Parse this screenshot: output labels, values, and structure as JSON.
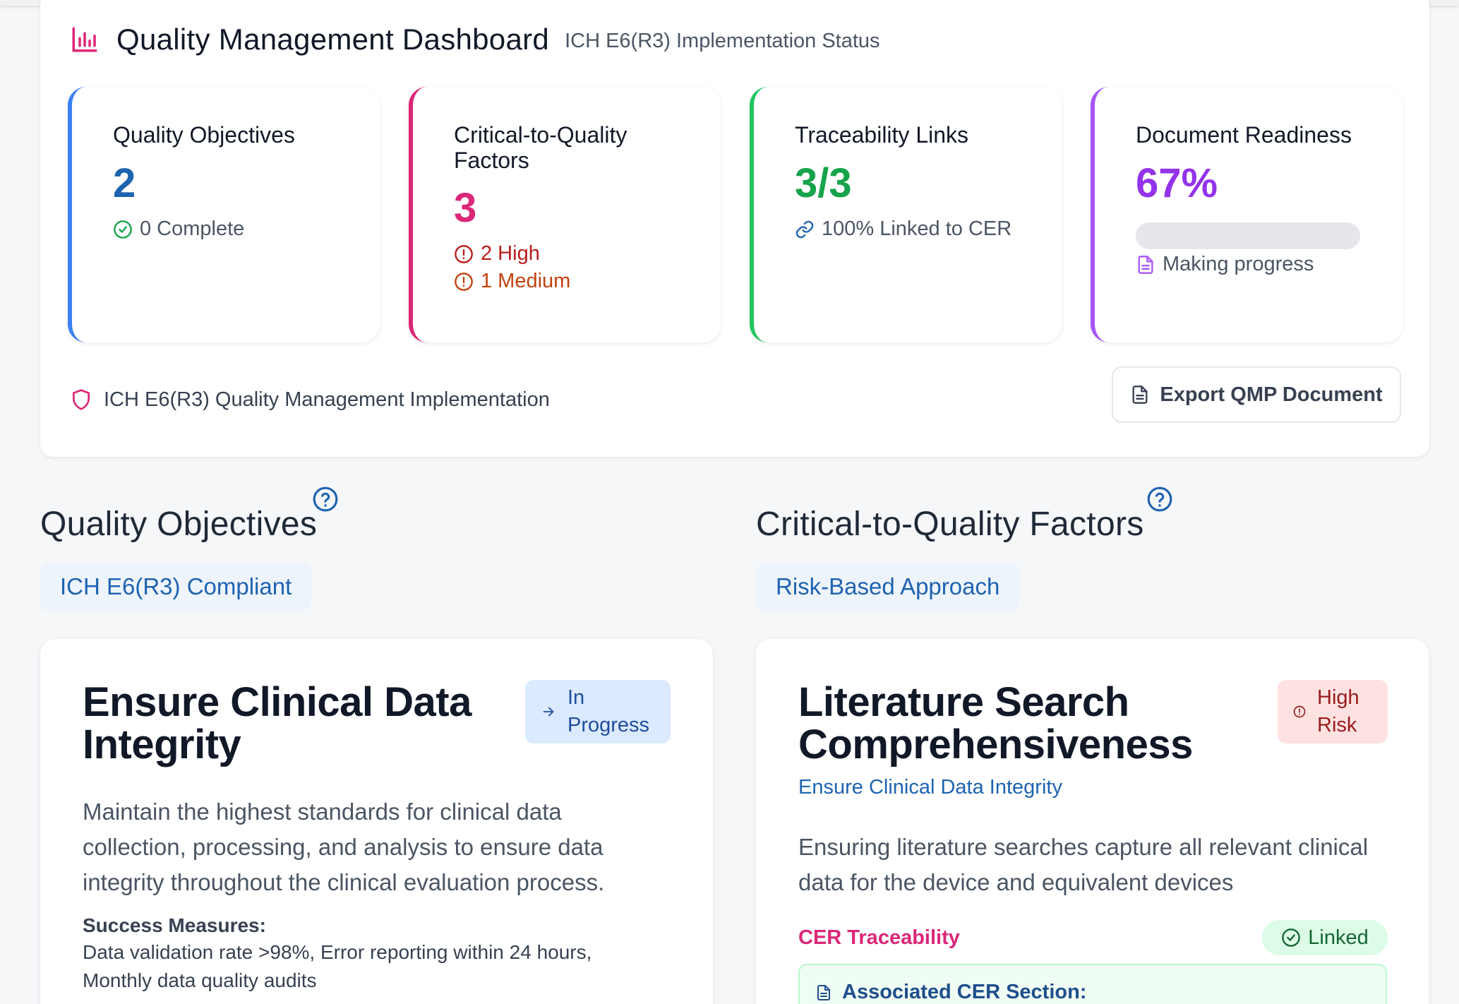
{
  "colors": {
    "blue": "#1e63b0",
    "pink": "#db2777",
    "green": "#16a34a",
    "purple": "#9333ea",
    "red": "#b91c1c",
    "orange": "#c2410c"
  },
  "dashboard": {
    "title": "Quality Management Dashboard",
    "subtitle": "ICH E6(R3) Implementation Status",
    "icon": "bar-chart-icon",
    "stats": [
      {
        "label": "Quality Objectives",
        "value": "2",
        "notes": [
          "0 Complete"
        ],
        "icon": "check-circle-icon"
      },
      {
        "label": "Critical-to-Quality Factors",
        "value": "3",
        "notes": [
          "2 High",
          "1 Medium"
        ],
        "icon": "alert-circle-icon"
      },
      {
        "label": "Traceability Links",
        "value": "3/3",
        "notes": [
          "100% Linked to CER"
        ],
        "icon": "link-icon"
      },
      {
        "label": "Document Readiness",
        "value": "67%",
        "progress": 0.67,
        "notes": [
          "Making progress"
        ],
        "icon": "file-icon"
      }
    ],
    "footer_text": "ICH E6(R3) Quality Management Implementation",
    "export_label": "Export QMP Document"
  },
  "objectives": {
    "title": "Quality Objectives",
    "pill": "ICH E6(R3) Compliant",
    "card": {
      "title": "Ensure Clinical Data Integrity",
      "status_line1": "In",
      "status_line2": "Progress",
      "description_lines": [
        "Maintain the highest standards for clinical data",
        "collection, processing, and analysis to ensure data",
        "integrity throughout the clinical evaluation process."
      ],
      "success_label": "Success Measures:",
      "success_lines": [
        "Data validation rate >98%, Error reporting within 24 hours,",
        "Monthly data quality audits"
      ]
    }
  },
  "ctq": {
    "title": "Critical-to-Quality Factors",
    "pill": "Risk-Based Approach",
    "card": {
      "title": "Literature Search Comprehensiveness",
      "risk_line1": "High",
      "risk_line2": "Risk",
      "linked_objective": "Ensure Clinical Data Integrity",
      "description_lines": [
        "Ensuring literature searches capture all relevant clinical",
        "data for the device and equivalent devices"
      ],
      "trace_label": "CER Traceability",
      "trace_status": "Linked",
      "assoc_label": "Associated CER Section:"
    }
  }
}
